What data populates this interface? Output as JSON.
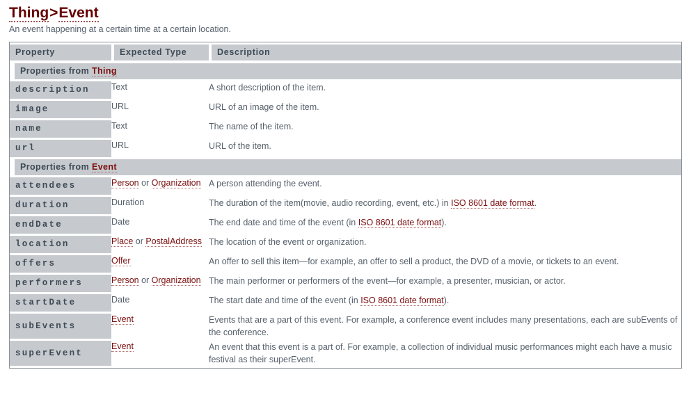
{
  "header": {
    "breadcrumb_parent": "Thing",
    "breadcrumb_separator": ">",
    "breadcrumb_current": "Event",
    "subtitle": "An event happening at a certain time at a certain location."
  },
  "table": {
    "columns": [
      "Property",
      "Expected Type",
      "Description"
    ],
    "sections": [
      {
        "label_prefix": "Properties from ",
        "label_link": "Thing",
        "rows": [
          {
            "property": "description",
            "types": [
              {
                "text": "Text",
                "link": false
              }
            ],
            "description": [
              {
                "text": "A short description of the item.",
                "link": false
              }
            ]
          },
          {
            "property": "image",
            "types": [
              {
                "text": "URL",
                "link": false
              }
            ],
            "description": [
              {
                "text": "URL of an image of the item.",
                "link": false
              }
            ]
          },
          {
            "property": "name",
            "types": [
              {
                "text": "Text",
                "link": false
              }
            ],
            "description": [
              {
                "text": "The name of the item.",
                "link": false
              }
            ]
          },
          {
            "property": "url",
            "types": [
              {
                "text": "URL",
                "link": false
              }
            ],
            "description": [
              {
                "text": "URL of the item.",
                "link": false
              }
            ]
          }
        ]
      },
      {
        "label_prefix": "Properties from ",
        "label_link": "Event",
        "rows": [
          {
            "property": "attendees",
            "types": [
              {
                "text": "Person",
                "link": true
              },
              {
                "text": " or ",
                "link": false
              },
              {
                "text": "Organization",
                "link": true
              }
            ],
            "description": [
              {
                "text": "A person attending the event.",
                "link": false
              }
            ]
          },
          {
            "property": "duration",
            "types": [
              {
                "text": "Duration",
                "link": false
              }
            ],
            "description": [
              {
                "text": "The duration of the item(movie, audio recording, event, etc.) in ",
                "link": false
              },
              {
                "text": "ISO 8601 date format",
                "link": true
              },
              {
                "text": ".",
                "link": false
              }
            ]
          },
          {
            "property": "endDate",
            "types": [
              {
                "text": "Date",
                "link": false
              }
            ],
            "description": [
              {
                "text": "The end date and time of the event (in ",
                "link": false
              },
              {
                "text": "ISO 8601 date format",
                "link": true
              },
              {
                "text": ").",
                "link": false
              }
            ]
          },
          {
            "property": "location",
            "types": [
              {
                "text": "Place",
                "link": true
              },
              {
                "text": " or ",
                "link": false
              },
              {
                "text": "PostalAddress",
                "link": true
              }
            ],
            "description": [
              {
                "text": "The location of the event or organization.",
                "link": false
              }
            ]
          },
          {
            "property": "offers",
            "types": [
              {
                "text": "Offer",
                "link": true
              }
            ],
            "description": [
              {
                "text": "An offer to sell this item—for example, an offer to sell a product, the DVD of a movie, or tickets to an event.",
                "link": false
              }
            ]
          },
          {
            "property": "performers",
            "types": [
              {
                "text": "Person",
                "link": true
              },
              {
                "text": " or ",
                "link": false
              },
              {
                "text": "Organization",
                "link": true
              }
            ],
            "description": [
              {
                "text": "The main performer or performers of the event—for example, a presenter, musician, or actor.",
                "link": false
              }
            ]
          },
          {
            "property": "startDate",
            "types": [
              {
                "text": "Date",
                "link": false
              }
            ],
            "description": [
              {
                "text": "The start date and time of the event (in ",
                "link": false
              },
              {
                "text": "ISO 8601 date format",
                "link": true
              },
              {
                "text": ").",
                "link": false
              }
            ]
          },
          {
            "property": "subEvents",
            "types": [
              {
                "text": "Event",
                "link": true
              }
            ],
            "description": [
              {
                "text": "Events that are a part of this event. For example, a conference event includes many presentations, each are subEvents of the conference.",
                "link": false
              }
            ]
          },
          {
            "property": "superEvent",
            "types": [
              {
                "text": "Event",
                "link": true
              }
            ],
            "description": [
              {
                "text": "An event that this event is a part of. For example, a collection of individual music performances might each have a music festival as their superEvent.",
                "link": false
              }
            ]
          }
        ]
      }
    ]
  },
  "colors": {
    "heading": "#660000",
    "link": "#7b0e0e",
    "cell_background": "#c6cace",
    "text": "#55606b",
    "table_border": "#8b9199"
  }
}
